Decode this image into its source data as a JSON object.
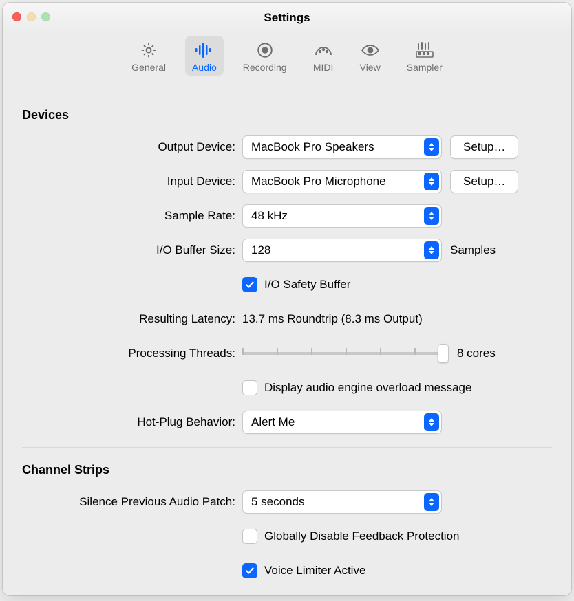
{
  "window": {
    "title": "Settings"
  },
  "tabs": {
    "general": {
      "label": "General"
    },
    "audio": {
      "label": "Audio",
      "selected": true
    },
    "recording": {
      "label": "Recording"
    },
    "midi": {
      "label": "MIDI"
    },
    "view": {
      "label": "View"
    },
    "sampler": {
      "label": "Sampler"
    }
  },
  "sections": {
    "devices": {
      "title": "Devices",
      "output_device": {
        "label": "Output Device:",
        "value": "MacBook Pro Speakers",
        "setup": "Setup…"
      },
      "input_device": {
        "label": "Input Device:",
        "value": "MacBook Pro Microphone",
        "setup": "Setup…"
      },
      "sample_rate": {
        "label": "Sample Rate:",
        "value": "48 kHz"
      },
      "io_buffer": {
        "label": "I/O Buffer Size:",
        "value": "128",
        "suffix": "Samples"
      },
      "io_safety": {
        "label": "I/O Safety Buffer",
        "checked": true
      },
      "latency": {
        "label": "Resulting Latency:",
        "value": "13.7 ms Roundtrip (8.3 ms Output)"
      },
      "threads": {
        "label": "Processing Threads:",
        "readout": "8 cores",
        "position": 1.0,
        "ticks": 7
      },
      "overload": {
        "label": "Display audio engine overload message",
        "checked": false
      },
      "hotplug": {
        "label": "Hot-Plug Behavior:",
        "value": "Alert Me"
      }
    },
    "channel_strips": {
      "title": "Channel Strips",
      "silence": {
        "label": "Silence Previous Audio Patch:",
        "value": "5 seconds"
      },
      "feedback": {
        "label": "Globally Disable Feedback Protection",
        "checked": false
      },
      "voice_limiter": {
        "label": "Voice Limiter Active",
        "checked": true
      }
    }
  }
}
